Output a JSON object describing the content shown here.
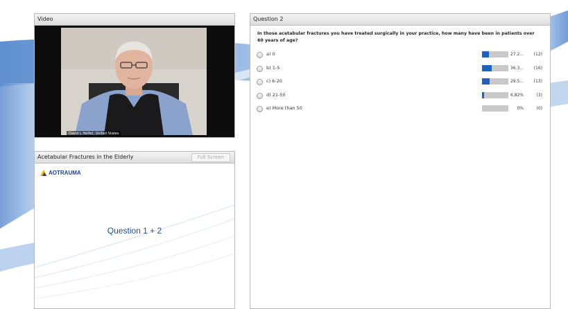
{
  "video": {
    "title": "Video",
    "caption": "David L Helfet, United States"
  },
  "slides": {
    "title": "Acetabular Fractures in the Elderly",
    "full_screen_label": "Full Screen",
    "logo_text": "AOTRAUMA",
    "slide_title": "Question 1 + 2"
  },
  "poll": {
    "title": "Question 2",
    "question": "In those acetabular fractures you have treated surgically in your practice, how many have been in patients over 60 years of age?",
    "answers": [
      {
        "label": "a) 0",
        "percent_text": "27.2...",
        "count": "(12)",
        "fraction": 0.272
      },
      {
        "label": "b) 1-5",
        "percent_text": "36.3...",
        "count": "(16)",
        "fraction": 0.363
      },
      {
        "label": "c) 6-20",
        "percent_text": "29.5...",
        "count": "(13)",
        "fraction": 0.295
      },
      {
        "label": "d) 21-50",
        "percent_text": "6.82%",
        "count": "(3)",
        "fraction": 0.0682
      },
      {
        "label": "e) More than 50",
        "percent_text": "0%",
        "count": "(0)",
        "fraction": 0
      }
    ]
  },
  "colors": {
    "bar_fill": "#1f62bd",
    "bar_track": "#c9c9c9",
    "background_band": "#7ea9dc",
    "slide_title": "#1e4f94"
  }
}
